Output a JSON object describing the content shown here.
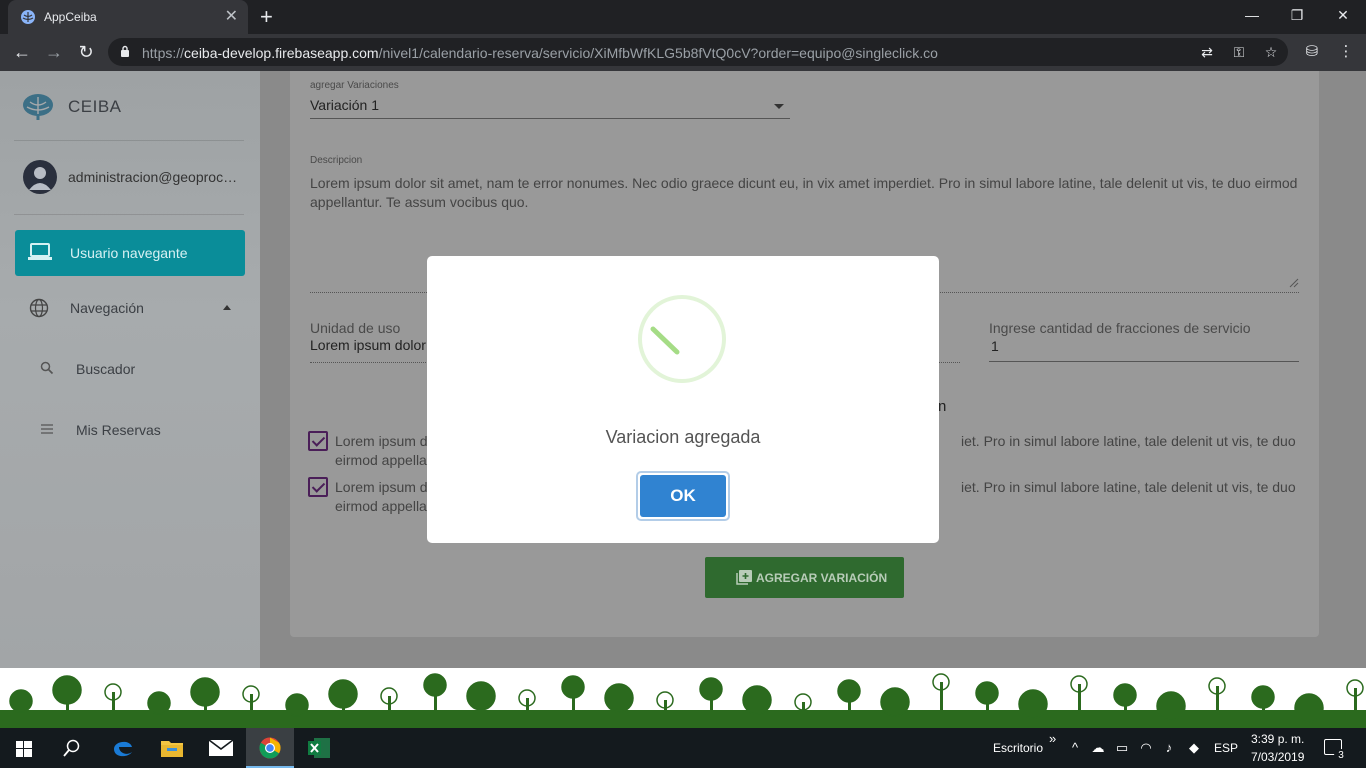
{
  "browser": {
    "tab_title": "AppCeiba",
    "tab_close": "✕",
    "new_tab": "+",
    "window_minimize": "—",
    "window_restore": "❐",
    "window_close": "✕",
    "url_scheme": "https://",
    "url_host": "ceiba-develop.firebaseapp.com",
    "url_path": "/nivel1/calendario-reserva/servicio/XiMfbWfKLG5b8fVtQ0cV?order=equipo@singleclick.co"
  },
  "sidebar": {
    "brand": "CEIBA",
    "user_email": "administracion@geoprocesamiento.co",
    "items": [
      {
        "label": "Usuario navegante",
        "icon": "laptop-icon",
        "active": true
      },
      {
        "label": "Navegación",
        "icon": "globe-icon",
        "expanded": true
      },
      {
        "label": "Buscador",
        "icon": "search-icon"
      },
      {
        "label": "Mis Reservas",
        "icon": "list-icon"
      }
    ]
  },
  "form": {
    "variation_label": "agregar Variaciones",
    "variation_value": "Variación 1",
    "description_label": "Descripcion",
    "description_value": "Lorem ipsum dolor sit amet, nam te error nonumes. Nec odio graece dicunt eu, in vix amet imperdiet. Pro in simul labore latine, tale delenit ut vis, te duo eirmod appellantur. Te assum vocibus quo.",
    "unit_label": "Unidad de uso",
    "unit_value": "Lorem ipsum dolor",
    "fractions_label": "Ingrese cantidad de fracciones de servicio",
    "fractions_value": "1",
    "section_fragment": "n",
    "check1_start": "Lorem ipsum d",
    "check1_end": "iet. Pro in simul labore latine, tale delenit ut vis, te duo",
    "check1_line2": "eirmod appella",
    "check2_start": "Lorem ipsum d",
    "check2_end": "iet. Pro in simul labore latine, tale delenit ut vis, te duo",
    "check2_line2": "eirmod appella",
    "add_button": "AGREGAR VARIACIÓN"
  },
  "modal": {
    "title": "Variacion agregada",
    "ok_label": "OK"
  },
  "taskbar": {
    "desktop_label": "Escritorio",
    "chevron": "»",
    "language": "ESP",
    "time": "3:39 p. m.",
    "date": "7/03/2019",
    "notifications_count": "3"
  },
  "colors": {
    "accent_teal": "#0a8d99",
    "button_green": "#2f6a2f",
    "ok_blue": "#3083d1",
    "spinner_green": "#a5dc86"
  }
}
